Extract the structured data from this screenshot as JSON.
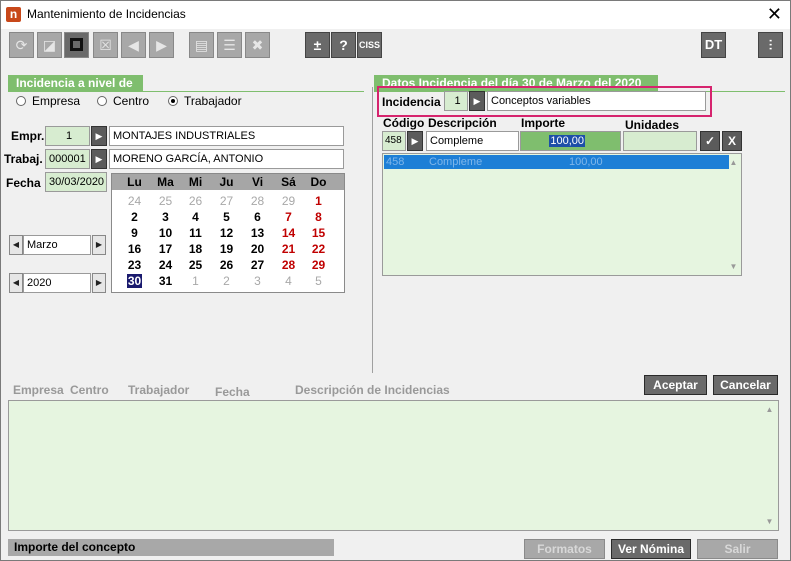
{
  "window": {
    "title": "Mantenimiento de Incidencias",
    "icon": "app-n-icon"
  },
  "toolbar": {
    "buttons": [
      "refresh-icon",
      "edit-icon",
      "select-icon",
      "delete-icon",
      "prev-icon",
      "next-icon",
      "print-icon",
      "list-icon",
      "excel-icon"
    ],
    "plusminus_label": "±",
    "help_label": "?",
    "ciss_label": "CISS",
    "dt_label": "DT",
    "settings_icon": "sliders-icon"
  },
  "level_section": {
    "header": "Incidencia a nivel de",
    "options": [
      {
        "label": "Empresa",
        "selected": false
      },
      {
        "label": "Centro",
        "selected": false
      },
      {
        "label": "Trabajador",
        "selected": true
      }
    ]
  },
  "fields": {
    "empresa": {
      "label": "Empr.",
      "code": "1",
      "name": "MONTAJES INDUSTRIALES"
    },
    "trabajador": {
      "label": "Trabaj.",
      "code": "000001",
      "name": "MORENO GARCÍA, ANTONIO"
    },
    "fecha": {
      "label": "Fecha",
      "value": "30/03/2020"
    }
  },
  "month_selector": {
    "value": "Marzo"
  },
  "year_selector": {
    "value": "2020"
  },
  "calendar": {
    "weekdays": [
      "Lu",
      "Ma",
      "Mi",
      "Ju",
      "Vi",
      "Sá",
      "Do"
    ],
    "weeks": [
      [
        {
          "d": "24",
          "t": "grey"
        },
        {
          "d": "25",
          "t": "grey"
        },
        {
          "d": "26",
          "t": "grey"
        },
        {
          "d": "27",
          "t": "grey"
        },
        {
          "d": "28",
          "t": "grey"
        },
        {
          "d": "29",
          "t": "grey"
        },
        {
          "d": "1",
          "t": "red"
        }
      ],
      [
        {
          "d": "2",
          "t": "n"
        },
        {
          "d": "3",
          "t": "n"
        },
        {
          "d": "4",
          "t": "n"
        },
        {
          "d": "5",
          "t": "n"
        },
        {
          "d": "6",
          "t": "n"
        },
        {
          "d": "7",
          "t": "red"
        },
        {
          "d": "8",
          "t": "red"
        }
      ],
      [
        {
          "d": "9",
          "t": "n"
        },
        {
          "d": "10",
          "t": "n"
        },
        {
          "d": "11",
          "t": "n"
        },
        {
          "d": "12",
          "t": "n"
        },
        {
          "d": "13",
          "t": "n"
        },
        {
          "d": "14",
          "t": "red"
        },
        {
          "d": "15",
          "t": "red"
        }
      ],
      [
        {
          "d": "16",
          "t": "n"
        },
        {
          "d": "17",
          "t": "n"
        },
        {
          "d": "18",
          "t": "n"
        },
        {
          "d": "19",
          "t": "n"
        },
        {
          "d": "20",
          "t": "n"
        },
        {
          "d": "21",
          "t": "red"
        },
        {
          "d": "22",
          "t": "red"
        }
      ],
      [
        {
          "d": "23",
          "t": "n"
        },
        {
          "d": "24",
          "t": "n"
        },
        {
          "d": "25",
          "t": "n"
        },
        {
          "d": "26",
          "t": "n"
        },
        {
          "d": "27",
          "t": "n"
        },
        {
          "d": "28",
          "t": "red"
        },
        {
          "d": "29",
          "t": "red"
        }
      ],
      [
        {
          "d": "30",
          "t": "sel"
        },
        {
          "d": "31",
          "t": "n"
        },
        {
          "d": "1",
          "t": "grey"
        },
        {
          "d": "2",
          "t": "grey"
        },
        {
          "d": "3",
          "t": "grey"
        },
        {
          "d": "4",
          "t": "grey"
        },
        {
          "d": "5",
          "t": "grey"
        }
      ]
    ]
  },
  "datos_section": {
    "header": "Datos Incidencia del día 30 de Marzo del 2020",
    "incidencia_label": "Incidencia",
    "incidencia_code": "1",
    "incidencia_desc": "Conceptos variables",
    "columns": {
      "codigo": "Código",
      "descripcion": "Descripción",
      "importe": "Importe",
      "unidades": "Unidades"
    },
    "edit_row": {
      "codigo": "458",
      "descripcion": "Compleme",
      "importe": "100,00",
      "unidades": ""
    },
    "confirm_label": "✓",
    "cancel_label": "X",
    "list_rows": [
      {
        "codigo": "458",
        "descripcion": "Compleme",
        "importe": "100,00"
      }
    ]
  },
  "buttons": {
    "aceptar": "Aceptar",
    "cancelar": "Cancelar",
    "formatos": "Formatos",
    "ver_nomina": "Ver Nómina",
    "salir": "Salir"
  },
  "grid": {
    "columns": [
      "Empresa",
      "Centro",
      "Trabajador",
      "Fecha",
      "Descripción de Incidencias"
    ]
  },
  "status": {
    "text": "Importe del concepto"
  },
  "colors": {
    "accent_green": "#7fbe6e",
    "field_green": "#d7ecd0",
    "highlight": "#d6246e",
    "selection": "#1d7fd6"
  }
}
